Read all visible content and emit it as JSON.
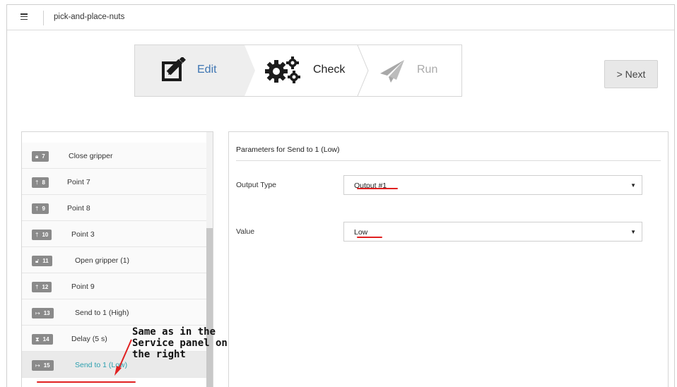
{
  "topbar": {
    "menu_icon": "hamburger-menu-icon",
    "title": "pick-and-place-nuts"
  },
  "stepper": {
    "edit": {
      "label": "Edit",
      "icon": "edit-icon",
      "state": "active",
      "color": "#3f76b3"
    },
    "check": {
      "label": "Check",
      "icon": "gears-icon",
      "state": "enabled"
    },
    "run": {
      "label": "Run",
      "icon": "paper-plane-icon",
      "state": "disabled"
    }
  },
  "next_button": {
    "label": "> Next"
  },
  "program_list": {
    "items": [
      {
        "number": "7",
        "icon": "lock-icon",
        "label": "Close gripper"
      },
      {
        "number": "8",
        "icon": "pin-icon",
        "label": "Point 7"
      },
      {
        "number": "9",
        "icon": "pin-icon",
        "label": "Point 8"
      },
      {
        "number": "10",
        "icon": "pin-icon",
        "label": "Point 3"
      },
      {
        "number": "11",
        "icon": "unlock-icon",
        "label": "Open gripper (1)"
      },
      {
        "number": "12",
        "icon": "pin-icon",
        "label": "Point 9"
      },
      {
        "number": "13",
        "icon": "signal-out-icon",
        "label": "Send to 1 (High)"
      },
      {
        "number": "14",
        "icon": "hourglass-icon",
        "label": "Delay (5 s)"
      },
      {
        "number": "15",
        "icon": "signal-out-icon",
        "label": "Send to 1 (Low)",
        "selected": true
      }
    ],
    "selected_color": "#2a9fae"
  },
  "parameters": {
    "title": "Parameters for  Send to 1 (Low)",
    "output_type": {
      "label": "Output Type",
      "value": "Output #1"
    },
    "value": {
      "label": "Value",
      "value": "Low"
    }
  },
  "annotation": {
    "text": "Same as in the Service panel on the right",
    "color": "#e02020"
  }
}
